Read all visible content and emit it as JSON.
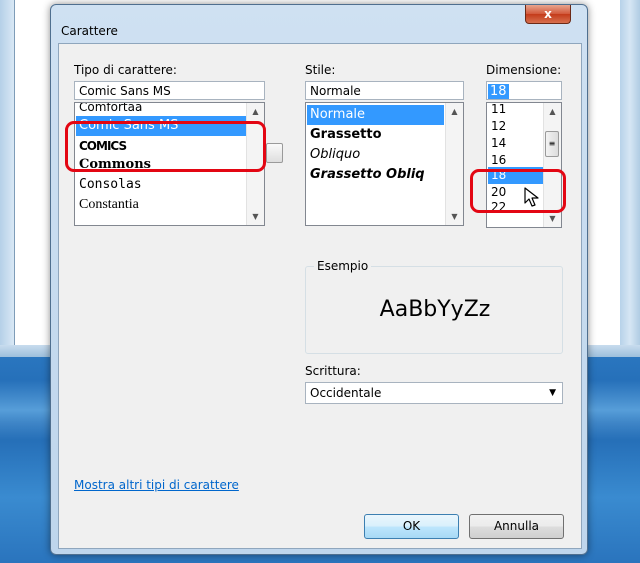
{
  "dialog": {
    "title": "Carattere",
    "close_label": "x"
  },
  "font": {
    "label": "Tipo di carattere:",
    "value": "Comic Sans MS",
    "items": [
      "Comfortaa",
      "Comic Sans MS",
      "COMICS",
      "Commons",
      "Consolas",
      "Constantia"
    ],
    "selected": "Comic Sans MS"
  },
  "style": {
    "label": "Stile:",
    "value": "Normale",
    "items": [
      "Normale",
      "Grassetto",
      "Obliquo",
      "Grassetto Obliq"
    ],
    "selected": "Normale"
  },
  "size": {
    "label": "Dimensione:",
    "value": "18",
    "items": [
      "11",
      "12",
      "14",
      "16",
      "18",
      "20",
      "22"
    ],
    "selected": "18"
  },
  "sample": {
    "label": "Esempio",
    "text": "AaBbYyZz"
  },
  "script": {
    "label": "Scrittura:",
    "value": "Occidentale"
  },
  "links": {
    "more_fonts": "Mostra altri tipi di carattere"
  },
  "buttons": {
    "ok": "OK",
    "cancel": "Annulla"
  },
  "colors": {
    "selection": "#3399ff",
    "highlight": "#e30613",
    "link": "#0066cc"
  }
}
